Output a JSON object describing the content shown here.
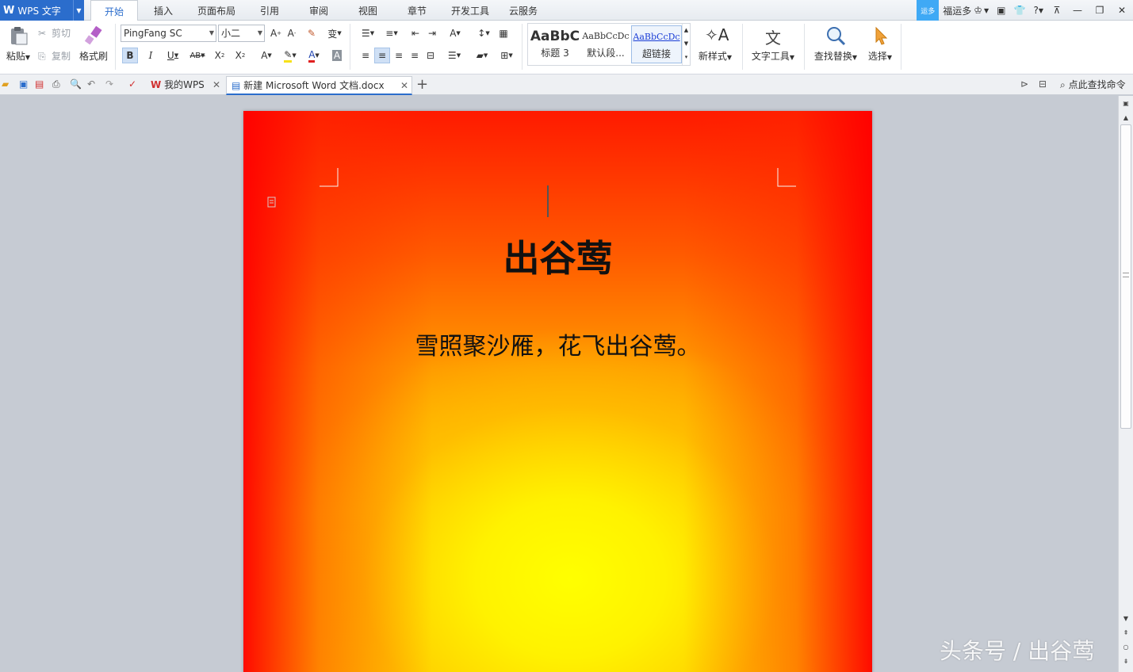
{
  "app": {
    "name": "WPS 文字"
  },
  "menu_tabs": [
    "开始",
    "插入",
    "页面布局",
    "引用",
    "审阅",
    "视图",
    "章节",
    "开发工具",
    "云服务"
  ],
  "active_tab": "开始",
  "topright": {
    "badge": "运多",
    "user": "福运多",
    "help": "?"
  },
  "ribbon": {
    "paste": "粘贴",
    "cut": "剪切",
    "copy": "复制",
    "format_painter": "格式刷",
    "font_name": "PingFang SC",
    "font_size": "小二",
    "styles": [
      {
        "preview": "AaBbC",
        "name": "标题 3"
      },
      {
        "preview": "AaBbCcDc",
        "name": "默认段..."
      },
      {
        "preview": "AaBbCcDc",
        "name": "超链接"
      }
    ],
    "new_style": "新样式",
    "text_tools": "文字工具",
    "find_replace": "查找替换",
    "select": "选择"
  },
  "doc_tabs": [
    {
      "label": "我的WPS"
    },
    {
      "label": "新建 Microsoft Word 文档.docx"
    }
  ],
  "search_cmd": "点此查找命令",
  "document": {
    "title": "出谷莺",
    "line": "雪照聚沙雁，花飞出谷莺。"
  },
  "watermark": "头条号 / 出谷莺",
  "colors": {
    "accent": "#2b6dcc",
    "page_red": "#ff1a00",
    "page_yellow": "#ffff00"
  }
}
